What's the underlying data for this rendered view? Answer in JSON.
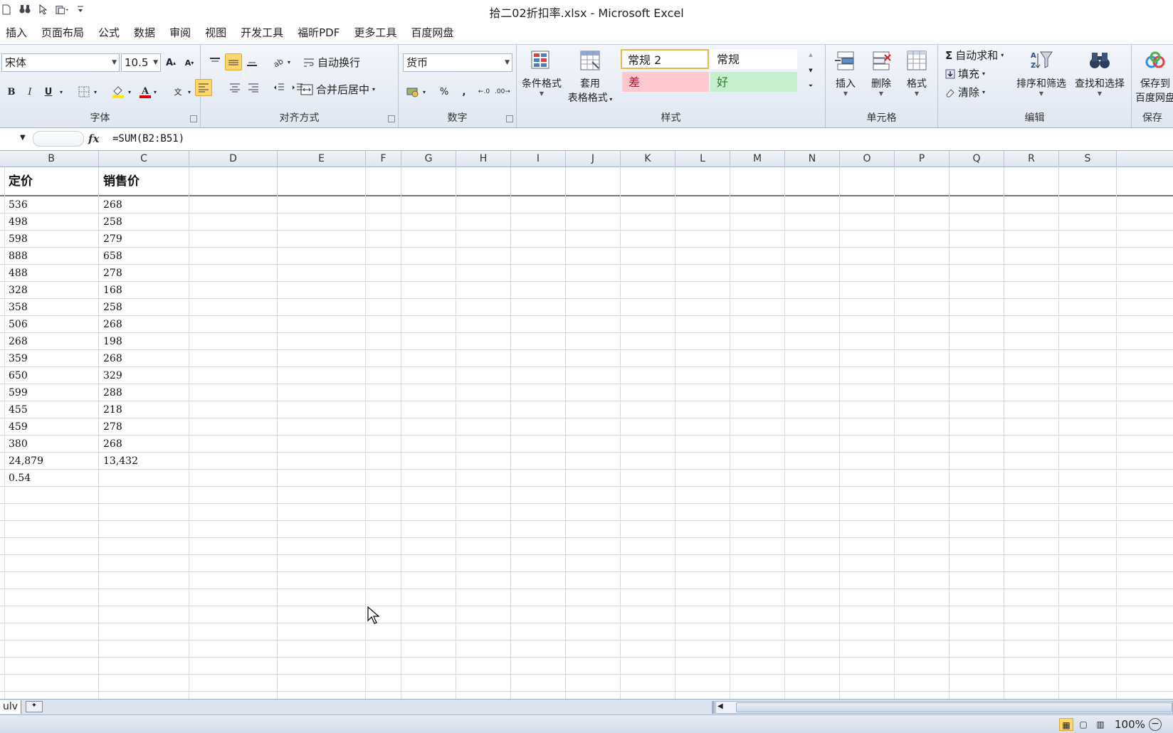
{
  "window": {
    "title": "拾二02折扣率.xlsx - Microsoft Excel"
  },
  "qat": {
    "icons": [
      "new-doc-icon",
      "binoculars-icon",
      "select-cursor-icon",
      "paste-special-icon",
      "customize-qat-icon"
    ]
  },
  "menu": {
    "tabs": [
      "插入",
      "页面布局",
      "公式",
      "数据",
      "审阅",
      "视图",
      "开发工具",
      "福昕PDF",
      "更多工具",
      "百度网盘"
    ]
  },
  "ribbon": {
    "font": {
      "label": "字体",
      "font_name": "宋体",
      "font_size": "10.5",
      "grow": "A",
      "shrink": "A",
      "bold": "B",
      "italic": "I",
      "underline": "U",
      "phonetic": "wén"
    },
    "alignment": {
      "label": "对齐方式",
      "wrap_text": "自动换行",
      "merge_center": "合并后居中"
    },
    "number": {
      "label": "数字",
      "format": "货币",
      "percent": "%",
      "comma": ","
    },
    "styles": {
      "label": "样式",
      "conditional_format": "条件格式",
      "table_format_1": "套用",
      "table_format_2": "表格格式",
      "style_normal2": "常规 2",
      "style_normal": "常规",
      "style_bad": "差",
      "style_good": "好"
    },
    "cells": {
      "label": "单元格",
      "insert": "插入",
      "delete": "删除",
      "format": "格式"
    },
    "editing": {
      "label": "编辑",
      "autosum": "自动求和",
      "fill": "填充",
      "clear": "清除",
      "sort_filter": "排序和筛选",
      "find_select": "查找和选择"
    },
    "save": {
      "label": "保存",
      "save_to_1": "保存到",
      "save_to_2": "百度网盘"
    }
  },
  "formula_bar": {
    "fx": "fx",
    "formula": "=SUM(B2:B51)"
  },
  "sheet": {
    "columns": [
      "B",
      "C",
      "D",
      "E",
      "F",
      "G",
      "H",
      "I",
      "J",
      "K",
      "L",
      "M",
      "N",
      "O",
      "P",
      "Q",
      "R",
      "S"
    ],
    "header": {
      "B": "定价",
      "C": "销售价"
    },
    "rows": [
      [
        "536",
        "268"
      ],
      [
        "498",
        "258"
      ],
      [
        "598",
        "279"
      ],
      [
        "888",
        "658"
      ],
      [
        "488",
        "278"
      ],
      [
        "328",
        "168"
      ],
      [
        "358",
        "258"
      ],
      [
        "506",
        "268"
      ],
      [
        "268",
        "198"
      ],
      [
        "359",
        "268"
      ],
      [
        "650",
        "329"
      ],
      [
        "599",
        "288"
      ],
      [
        "455",
        "218"
      ],
      [
        "459",
        "278"
      ],
      [
        "380",
        "268"
      ],
      [
        "24,879",
        "13,432"
      ],
      [
        "0.54",
        ""
      ]
    ]
  },
  "sheet_tabs": {
    "active": "ulv"
  },
  "status": {
    "zoom": "100%"
  }
}
